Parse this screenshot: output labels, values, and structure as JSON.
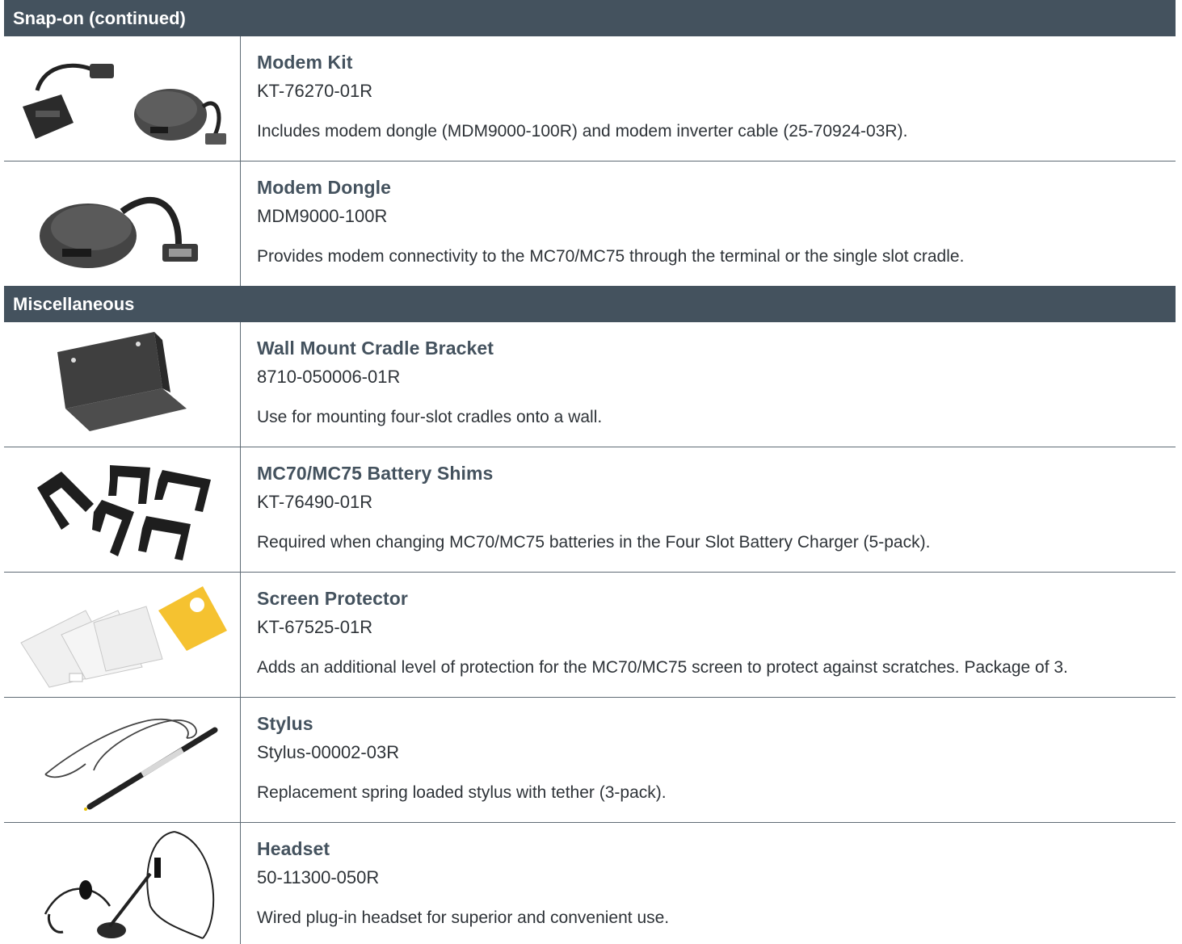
{
  "sections": [
    {
      "heading": "Snap-on (continued)",
      "items": [
        {
          "title": "Modem Kit",
          "part": "KT-76270-01R",
          "desc": "Includes modem dongle (MDM9000-100R) and modem inverter cable (25-70924-03R)."
        },
        {
          "title": "Modem Dongle",
          "part": "MDM9000-100R",
          "desc": "Provides modem connectivity to the MC70/MC75 through the terminal or the single slot cradle."
        }
      ]
    },
    {
      "heading": "Miscellaneous",
      "items": [
        {
          "title": "Wall Mount Cradle Bracket",
          "part": "8710-050006-01R",
          "desc": "Use for mounting four-slot cradles onto a wall."
        },
        {
          "title": "MC70/MC75 Battery Shims",
          "part": "KT-76490-01R",
          "desc": "Required when changing MC70/MC75 batteries in the Four Slot Battery Charger (5-pack)."
        },
        {
          "title": "Screen Protector",
          "part": "KT-67525-01R",
          "desc": "Adds an additional level of protection for the MC70/MC75 screen to protect against scratches. Package of 3."
        },
        {
          "title": "Stylus",
          "part": "Stylus-00002-03R",
          "desc": "Replacement spring loaded stylus with tether (3-pack)."
        },
        {
          "title": "Headset",
          "part": "50-11300-050R",
          "desc": "Wired plug-in headset for superior and convenient use."
        }
      ]
    }
  ],
  "colors": {
    "header_bg": "#44525e",
    "title_text": "#44525e",
    "body_text": "#2e3338",
    "rule": "#5f6b75"
  }
}
